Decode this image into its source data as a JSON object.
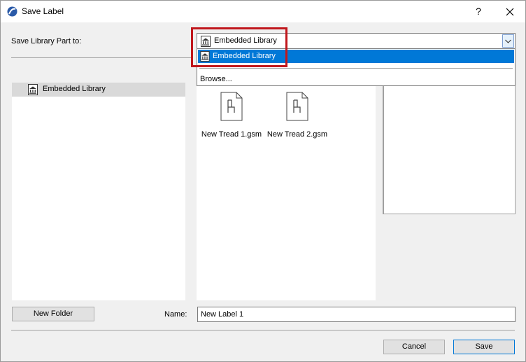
{
  "window": {
    "title": "Save Label",
    "help_label": "?",
    "close_label": "×"
  },
  "save_to": {
    "label": "Save Library Part to:",
    "selected": "Embedded Library",
    "dropdown": {
      "options": [
        "Embedded Library"
      ],
      "browse_label": "Browse..."
    }
  },
  "folder_tree": {
    "items": [
      {
        "label": "Embedded Library",
        "icon": "library-icon",
        "selected": true
      }
    ]
  },
  "files": [
    {
      "name": "New Tread 1.gsm",
      "icon": "chair-file-icon"
    },
    {
      "name": "New Tread 2.gsm",
      "icon": "chair-file-icon"
    }
  ],
  "footer": {
    "new_folder_label": "New Folder",
    "name_label": "Name:",
    "name_value": "New Label 1",
    "cancel_label": "Cancel",
    "save_label": "Save"
  },
  "colors": {
    "accent": "#0078d7",
    "highlight_box": "#c0171c"
  }
}
